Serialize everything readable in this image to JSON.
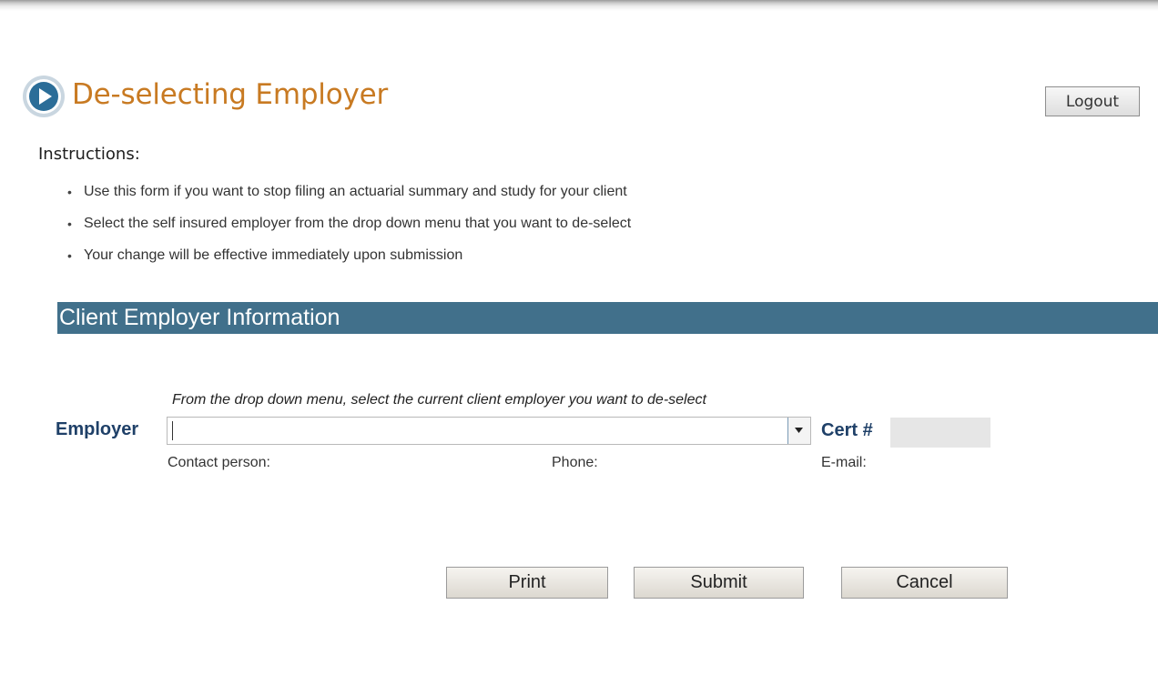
{
  "header": {
    "title": "De-selecting Employer",
    "logout_label": "Logout",
    "icon": "play-circle-icon"
  },
  "instructions": {
    "heading": "Instructions:",
    "items": [
      "Use this form if you want to stop filing an actuarial summary and study for your client",
      "Select the self insured employer from the drop down menu that you want to de-select",
      "Your change will be effective immediately upon submission"
    ]
  },
  "section": {
    "title": "Client Employer Information",
    "bar_color": "#41708b"
  },
  "form": {
    "hint": "From the drop down menu, select the current client employer you want to de-select",
    "employer_label": "Employer",
    "employer_value": "",
    "cert_label": "Cert #",
    "cert_value": "",
    "contact_label": "Contact person:",
    "phone_label": "Phone:",
    "email_label": "E-mail:"
  },
  "actions": {
    "print_label": "Print",
    "submit_label": "Submit",
    "cancel_label": "Cancel"
  },
  "colors": {
    "title": "#c87a22",
    "label": "#1f4068",
    "icon": "#2b6d98"
  }
}
